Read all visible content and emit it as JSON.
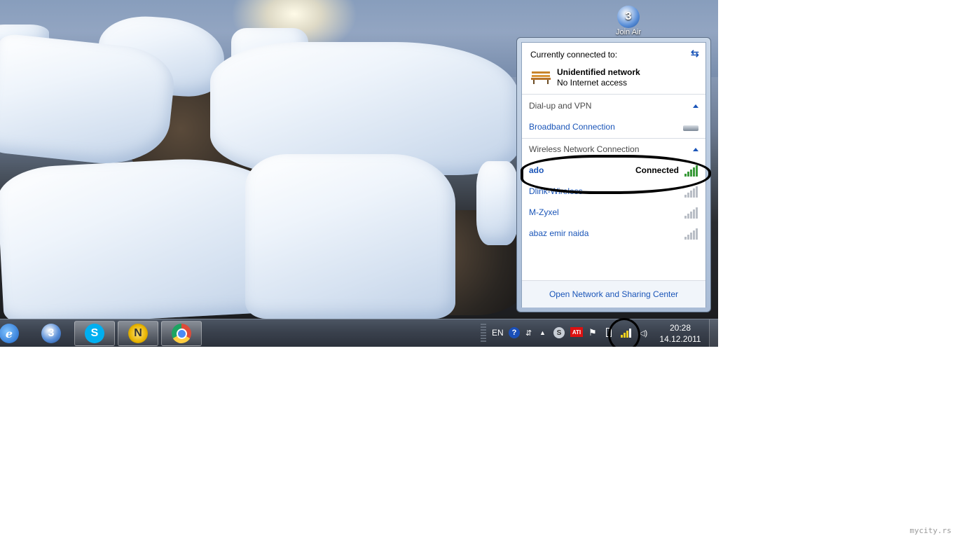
{
  "desktop": {
    "icons": [
      {
        "label": "Join Air",
        "icon": "join-air-icon"
      }
    ]
  },
  "taskbar": {
    "pinned": [
      {
        "name": "internet-explorer",
        "icon": "ie-icon",
        "color": "#2a78d6"
      },
      {
        "name": "join-air",
        "icon": "join-air-icon",
        "color": "#3b6fc4"
      },
      {
        "name": "skype",
        "icon": "skype-icon",
        "color": "#00aff0"
      },
      {
        "name": "norton",
        "icon": "norton-icon",
        "color": "#e8b400"
      },
      {
        "name": "chrome",
        "icon": "chrome-icon",
        "color": "#dd4b39"
      }
    ],
    "tray": {
      "language": "EN",
      "help": "?",
      "ati": "ATI",
      "icons": [
        "help-icon",
        "network-switch-icon",
        "show-hidden-icons-chevron",
        "skype-tray-icon",
        "ati-icon",
        "action-center-flag-icon",
        "battery-icon",
        "wireless-signal-icon",
        "volume-icon"
      ]
    },
    "clock": {
      "time": "20:28",
      "date": "14.12.2011"
    }
  },
  "flyout": {
    "header": "Currently connected to:",
    "current": {
      "name": "Unidentified network",
      "status": "No Internet access"
    },
    "sections": [
      {
        "title": "Dial-up and VPN",
        "items": [
          {
            "name": "Broadband Connection"
          }
        ]
      },
      {
        "title": "Wireless Network Connection",
        "items": [
          {
            "name": "ado",
            "status": "Connected",
            "signal": 5
          },
          {
            "name": "Dlink-Wireless",
            "status": "",
            "signal": 5
          },
          {
            "name": "M-Zyxel",
            "status": "",
            "signal": 5
          },
          {
            "name": "abaz emir naida",
            "status": "",
            "signal": 5
          }
        ]
      }
    ],
    "footer_link": "Open Network and Sharing Center"
  },
  "watermark": "mycity.rs"
}
